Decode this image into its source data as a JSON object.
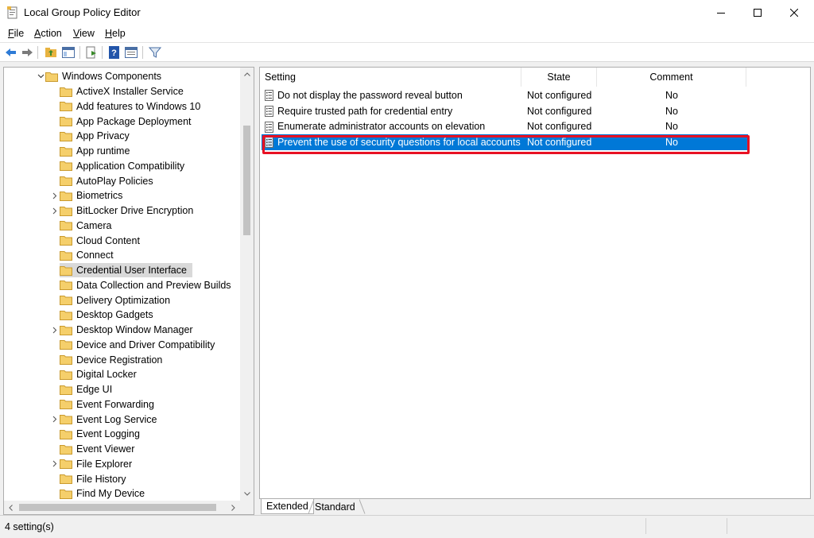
{
  "window": {
    "title": "Local Group Policy Editor"
  },
  "menu": {
    "file": "File",
    "action": "Action",
    "view": "View",
    "help": "Help"
  },
  "toolbar_icons": [
    "back-arrow-icon",
    "forward-arrow-icon",
    "up-folder-icon",
    "show-hide-tree-icon",
    "export-list-icon",
    "help-icon",
    "properties-icon",
    "filter-icon"
  ],
  "tree": {
    "parent": "Windows Components",
    "items": [
      {
        "label": "ActiveX Installer Service",
        "expandable": false
      },
      {
        "label": "Add features to Windows 10",
        "expandable": false
      },
      {
        "label": "App Package Deployment",
        "expandable": false
      },
      {
        "label": "App Privacy",
        "expandable": false
      },
      {
        "label": "App runtime",
        "expandable": false
      },
      {
        "label": "Application Compatibility",
        "expandable": false
      },
      {
        "label": "AutoPlay Policies",
        "expandable": false
      },
      {
        "label": "Biometrics",
        "expandable": true
      },
      {
        "label": "BitLocker Drive Encryption",
        "expandable": true
      },
      {
        "label": "Camera",
        "expandable": false
      },
      {
        "label": "Cloud Content",
        "expandable": false
      },
      {
        "label": "Connect",
        "expandable": false
      },
      {
        "label": "Credential User Interface",
        "expandable": false,
        "selected": true
      },
      {
        "label": "Data Collection and Preview Builds",
        "expandable": false
      },
      {
        "label": "Delivery Optimization",
        "expandable": false
      },
      {
        "label": "Desktop Gadgets",
        "expandable": false
      },
      {
        "label": "Desktop Window Manager",
        "expandable": true
      },
      {
        "label": "Device and Driver Compatibility",
        "expandable": false
      },
      {
        "label": "Device Registration",
        "expandable": false
      },
      {
        "label": "Digital Locker",
        "expandable": false
      },
      {
        "label": "Edge UI",
        "expandable": false
      },
      {
        "label": "Event Forwarding",
        "expandable": false
      },
      {
        "label": "Event Log Service",
        "expandable": true
      },
      {
        "label": "Event Logging",
        "expandable": false
      },
      {
        "label": "Event Viewer",
        "expandable": false
      },
      {
        "label": "File Explorer",
        "expandable": true
      },
      {
        "label": "File History",
        "expandable": false
      },
      {
        "label": "Find My Device",
        "expandable": false
      }
    ]
  },
  "list": {
    "columns": {
      "setting": "Setting",
      "state": "State",
      "comment": "Comment"
    },
    "rows": [
      {
        "setting": "Do not display the password reveal button",
        "state": "Not configured",
        "comment": "No"
      },
      {
        "setting": "Require trusted path for credential entry",
        "state": "Not configured",
        "comment": "No"
      },
      {
        "setting": "Enumerate administrator accounts on elevation",
        "state": "Not configured",
        "comment": "No"
      },
      {
        "setting": "Prevent the use of security questions for local accounts",
        "state": "Not configured",
        "comment": "No",
        "selected": true
      }
    ]
  },
  "tabs": {
    "extended": "Extended",
    "standard": "Standard"
  },
  "status": {
    "text": "4 setting(s)"
  },
  "colors": {
    "selection": "#0078d7",
    "highlight_box": "#e81123",
    "tree_selected": "#d9d9d9",
    "folder": "#f5cf6b"
  }
}
